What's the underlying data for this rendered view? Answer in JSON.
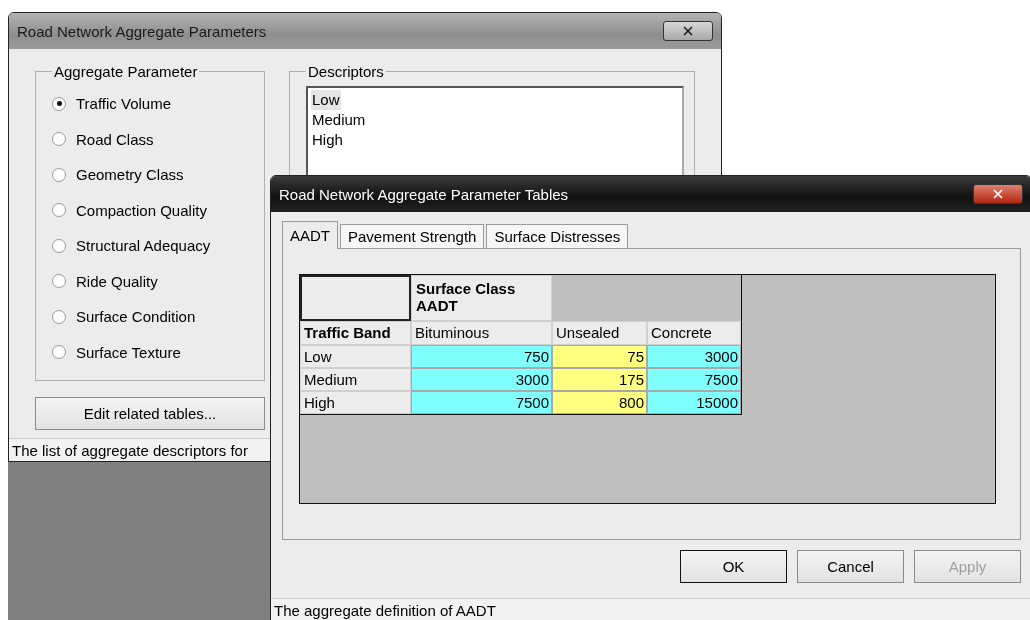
{
  "main_window": {
    "title": "Road Network Aggregate Parameters",
    "aggregate_parameter": {
      "label": "Aggregate Parameter",
      "options": [
        {
          "label": "Traffic Volume",
          "selected": true
        },
        {
          "label": "Road Class",
          "selected": false
        },
        {
          "label": "Geometry Class",
          "selected": false
        },
        {
          "label": "Compaction Quality",
          "selected": false
        },
        {
          "label": "Structural Adequacy",
          "selected": false
        },
        {
          "label": "Ride Quality",
          "selected": false
        },
        {
          "label": "Surface Condition",
          "selected": false
        },
        {
          "label": "Surface Texture",
          "selected": false
        }
      ]
    },
    "descriptors": {
      "label": "Descriptors",
      "items": [
        {
          "label": "Low",
          "selected": true
        },
        {
          "label": "Medium",
          "selected": false
        },
        {
          "label": "High",
          "selected": false
        }
      ]
    },
    "edit_button": "Edit related tables...",
    "status_bar": "The list of aggregate descriptors for"
  },
  "tables_window": {
    "title": "Road Network Aggregate Parameter Tables",
    "tabs": [
      {
        "label": "AADT",
        "selected": true
      },
      {
        "label": "Pavement Strength",
        "selected": false
      },
      {
        "label": "Surface Distresses",
        "selected": false
      }
    ],
    "grid": {
      "group_header": "Surface Class\nAADT",
      "row_header_label": "Traffic Band",
      "columns": [
        "Bituminous",
        "Unsealed",
        "Concrete"
      ],
      "rows": [
        {
          "label": "Low",
          "cells": [
            {
              "value": "750",
              "color": "#80ffff"
            },
            {
              "value": "75",
              "color": "#ffff80"
            },
            {
              "value": "3000",
              "color": "#80ffff"
            }
          ]
        },
        {
          "label": "Medium",
          "cells": [
            {
              "value": "3000",
              "color": "#80ffff"
            },
            {
              "value": "175",
              "color": "#ffff80"
            },
            {
              "value": "7500",
              "color": "#80ffff"
            }
          ]
        },
        {
          "label": "High",
          "cells": [
            {
              "value": "7500",
              "color": "#80ffff"
            },
            {
              "value": "800",
              "color": "#ffff80"
            },
            {
              "value": "15000",
              "color": "#80ffff"
            }
          ]
        }
      ]
    },
    "buttons": [
      {
        "label": "OK",
        "disabled": false,
        "default": true
      },
      {
        "label": "Cancel",
        "disabled": false,
        "default": false
      },
      {
        "label": "Apply",
        "disabled": true,
        "default": false
      }
    ],
    "status_bar": "The aggregate definition of AADT"
  }
}
